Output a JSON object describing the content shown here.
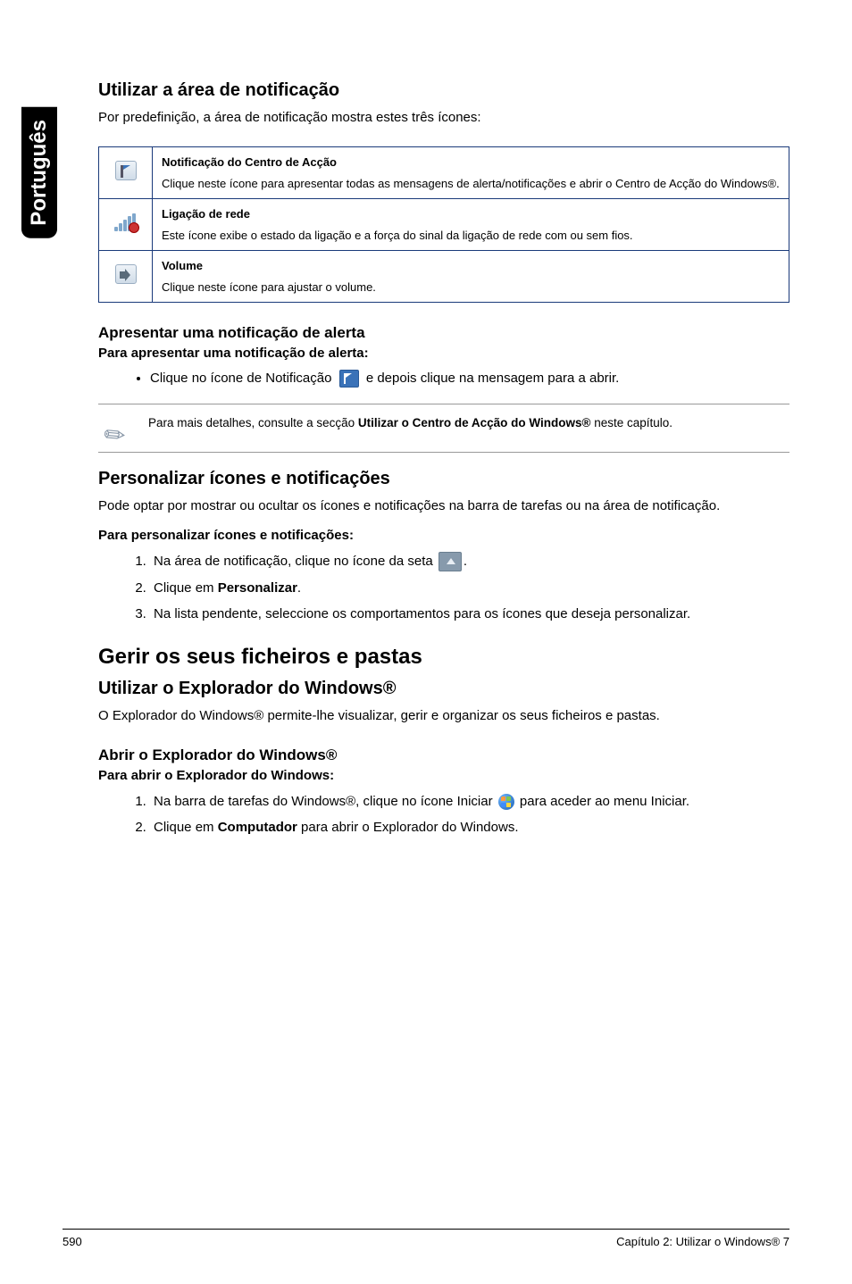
{
  "lang_tab": "Português",
  "section1": {
    "heading": "Utilizar a área de notificação",
    "intro": "Por predefinição, a área de notificação mostra estes três ícones:"
  },
  "icon_table": {
    "rows": [
      {
        "title": "Notificação do Centro de Acção",
        "desc": "Clique neste ícone para apresentar todas as mensagens de alerta/notificações e abrir o Centro de Acção do Windows®."
      },
      {
        "title": "Ligação de rede",
        "desc": "Este ícone exibe o estado da ligação e a força do sinal da ligação de rede com ou sem fios."
      },
      {
        "title": "Volume",
        "desc": "Clique neste ícone para ajustar o volume."
      }
    ]
  },
  "alert": {
    "heading": "Apresentar uma notificação de alerta",
    "sub": "Para apresentar uma notificação de alerta:",
    "bullet_before": "Clique no ícone de Notificação ",
    "bullet_after": " e depois clique na mensagem para a abrir."
  },
  "note": {
    "before": "Para mais detalhes, consulte a secção ",
    "bold": "Utilizar o Centro de Acção do Windows®",
    "after": " neste capítulo."
  },
  "personalize": {
    "heading": "Personalizar ícones e notificações",
    "intro": "Pode optar por mostrar ou ocultar os ícones e notificações na barra de tarefas ou na área de notificação.",
    "sub": "Para personalizar ícones e notificações:",
    "step1_before": "Na área de notificação, clique no ícone da seta ",
    "step1_after": ".",
    "step2_before": "Clique em ",
    "step2_bold": "Personalizar",
    "step2_after": ".",
    "step3": "Na lista pendente, seleccione os comportamentos para os ícones que deseja personalizar."
  },
  "files": {
    "heading": "Gerir os seus ficheiros e pastas",
    "explorer_h": "Utilizar o Explorador do Windows®",
    "explorer_p": "O Explorador do Windows® permite-lhe visualizar, gerir e organizar os seus ficheiros e pastas.",
    "open_h": "Abrir o Explorador do Windows®",
    "open_sub": "Para abrir o Explorador do Windows:",
    "step1_before": "Na barra de tarefas do Windows®, clique no ícone Iniciar ",
    "step1_after": " para aceder ao menu Iniciar.",
    "step2_before": "Clique em ",
    "step2_bold": "Computador",
    "step2_after": " para abrir o Explorador do Windows."
  },
  "footer": {
    "page": "590",
    "chapter": "Capítulo 2: Utilizar o Windows® 7"
  }
}
